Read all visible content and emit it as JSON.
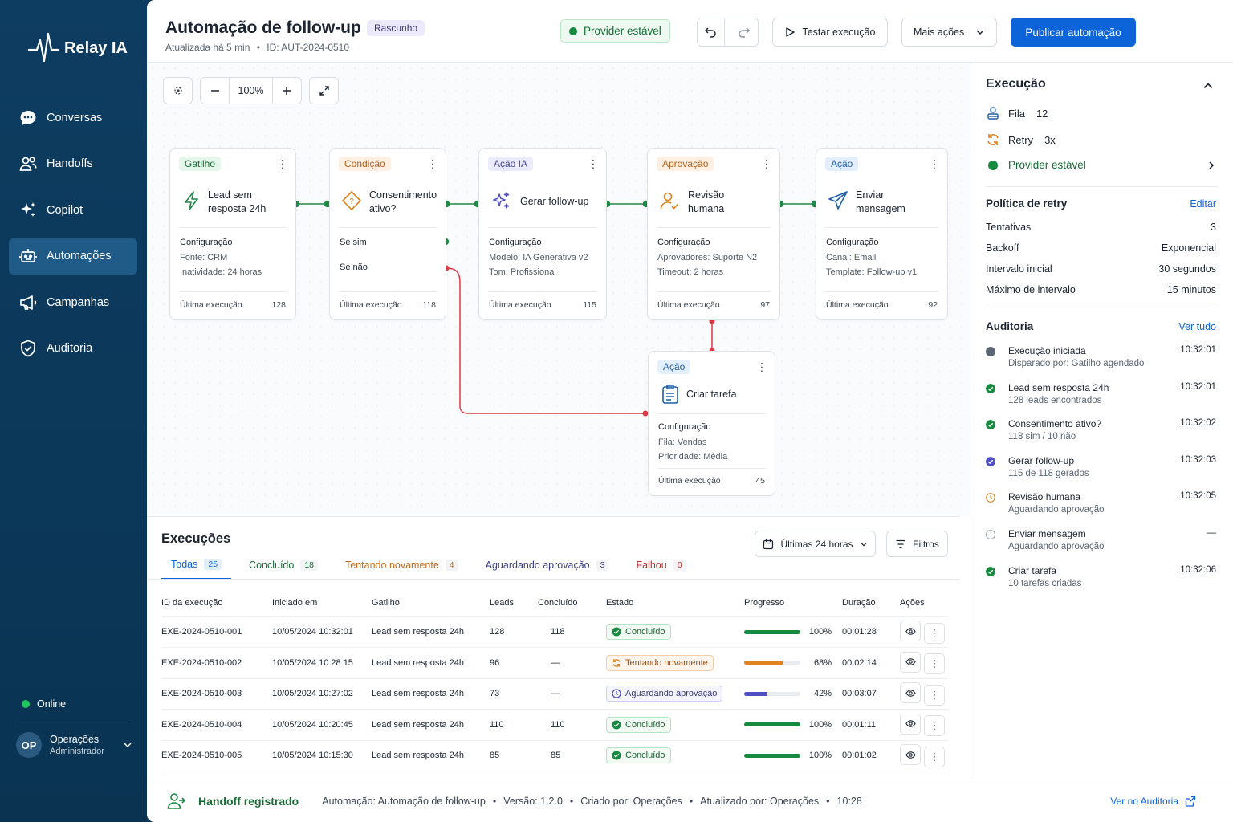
{
  "brand": {
    "name": "Relay IA"
  },
  "nav": [
    {
      "label": "Conversas",
      "icon": "chat-bubble-icon"
    },
    {
      "label": "Handoffs",
      "icon": "users-icon"
    },
    {
      "label": "Copilot",
      "icon": "sparkles-icon"
    },
    {
      "label": "Automações",
      "icon": "robot-icon",
      "active": true
    },
    {
      "label": "Campanhas",
      "icon": "megaphone-icon"
    },
    {
      "label": "Auditoria",
      "icon": "shield-check-icon"
    }
  ],
  "status": {
    "online": "Online"
  },
  "user": {
    "initials": "OP",
    "name": "Operações",
    "role": "Administrador"
  },
  "header": {
    "title": "Automação de follow-up",
    "draft_badge": "Rascunho",
    "updated": "Atualizada há 5 min",
    "separator": "•",
    "id": "ID: AUT-2024-0510",
    "provider_status": "Provider estável",
    "test_label": "Testar execução",
    "more_label": "Mais ações",
    "publish_label": "Publicar automação"
  },
  "canvas": {
    "zoom": "100%"
  },
  "nodes": [
    {
      "tag": "Gatilho",
      "name": [
        "Lead sem",
        "resposta 24h"
      ],
      "conf_title": "Configuração",
      "conf": [
        "Fonte: CRM",
        "Inatividade: 24 horas"
      ],
      "last_label": "Última execução",
      "last": "128"
    },
    {
      "tag": "Condição",
      "name": [
        "Consentimento",
        "ativo?"
      ],
      "branch_yes": "Se sim",
      "branch_no": "Se não",
      "last_label": "Última execução",
      "last": "118"
    },
    {
      "tag": "Ação IA",
      "name": [
        "Gerar follow-up"
      ],
      "conf_title": "Configuração",
      "conf": [
        "Modelo: IA Generativa v2",
        "Tom: Profissional"
      ],
      "last_label": "Última execução",
      "last": "115"
    },
    {
      "tag": "Aprovação",
      "name": [
        "Revisão",
        "humana"
      ],
      "conf_title": "Configuração",
      "conf": [
        "Aprovadores: Suporte N2",
        "Timeout: 2 horas"
      ],
      "last_label": "Última execução",
      "last": "97"
    },
    {
      "tag": "Ação",
      "name": [
        "Enviar",
        "mensagem"
      ],
      "conf_title": "Configuração",
      "conf": [
        "Canal: Email",
        "Template: Follow-up v1"
      ],
      "last_label": "Última execução",
      "last": "92"
    },
    {
      "tag": "Ação",
      "name": [
        "Criar tarefa"
      ],
      "conf_title": "Configuração",
      "conf": [
        "Fila: Vendas",
        "Prioridade: Média"
      ],
      "last_label": "Última execução",
      "last": "45"
    }
  ],
  "executions": {
    "title": "Execuções",
    "range": "Últimas 24 horas",
    "filters": "Filtros",
    "tabs": [
      {
        "label": "Todas",
        "count": "25",
        "color": "#0d63d8"
      },
      {
        "label": "Concluído",
        "count": "18",
        "color": "#1a6a36"
      },
      {
        "label": "Tentando novamente",
        "count": "4",
        "color": "#c46a1c"
      },
      {
        "label": "Aguardando aprovação",
        "count": "3",
        "color": "#3c3f8a"
      },
      {
        "label": "Falhou",
        "count": "0",
        "color": "#c62828"
      }
    ],
    "columns": [
      "ID da execução",
      "Iniciado em",
      "Gatilho",
      "Leads",
      "Concluído",
      "Estado",
      "Progresso",
      "Duração",
      "Ações"
    ],
    "rows": [
      {
        "id": "EXE-2024-0510-001",
        "start": "10/05/2024 10:32:01",
        "trigger": "Lead sem resposta 24h",
        "leads": "128",
        "done": "118",
        "state": "Concluído",
        "kind": "ok",
        "progress": 100,
        "pct": "100%",
        "duration": "00:01:28"
      },
      {
        "id": "EXE-2024-0510-002",
        "start": "10/05/2024 10:28:15",
        "trigger": "Lead sem resposta 24h",
        "leads": "96",
        "done": "—",
        "state": "Tentando novamente",
        "kind": "retry",
        "progress": 68,
        "pct": "68%",
        "duration": "00:02:14"
      },
      {
        "id": "EXE-2024-0510-003",
        "start": "10/05/2024 10:27:02",
        "trigger": "Lead sem resposta 24h",
        "leads": "73",
        "done": "—",
        "state": "Aguardando aprovação",
        "kind": "wait",
        "progress": 42,
        "pct": "42%",
        "duration": "00:03:07"
      },
      {
        "id": "EXE-2024-0510-004",
        "start": "10/05/2024 10:20:45",
        "trigger": "Lead sem resposta 24h",
        "leads": "110",
        "done": "110",
        "state": "Concluído",
        "kind": "ok",
        "progress": 100,
        "pct": "100%",
        "duration": "00:01:11"
      },
      {
        "id": "EXE-2024-0510-005",
        "start": "10/05/2024 10:15:30",
        "trigger": "Lead sem resposta 24h",
        "leads": "85",
        "done": "85",
        "state": "Concluído",
        "kind": "ok",
        "progress": 100,
        "pct": "100%",
        "duration": "00:01:02"
      }
    ]
  },
  "panel": {
    "title": "Execução",
    "queue_label": "Fila",
    "queue": "12",
    "retry_label": "Retry",
    "retry": "3x",
    "provider": "Provider estável",
    "policy_title": "Política de retry",
    "edit": "Editar",
    "policy": [
      {
        "k": "Tentativas",
        "v": "3"
      },
      {
        "k": "Backoff",
        "v": "Exponencial"
      },
      {
        "k": "Intervalo inicial",
        "v": "30 segundos"
      },
      {
        "k": "Máximo de intervalo",
        "v": "15 minutos"
      }
    ],
    "audit_title": "Auditoria",
    "see_all": "Ver tudo",
    "audit": [
      {
        "t1": "Execução iniciada",
        "t2": "Disparado por: Gatilho agendado",
        "time": "10:32:01",
        "kind": "start"
      },
      {
        "t1": "Lead sem resposta 24h",
        "t2": "128 leads encontrados",
        "time": "10:32:01",
        "kind": "ok"
      },
      {
        "t1": "Consentimento ativo?",
        "t2": "118 sim / 10 não",
        "time": "10:32:02",
        "kind": "ok"
      },
      {
        "t1": "Gerar follow-up",
        "t2": "115 de 118 gerados",
        "time": "10:32:03",
        "kind": "ai"
      },
      {
        "t1": "Revisão humana",
        "t2": "Aguardando aprovação",
        "time": "10:32:05",
        "kind": "pending"
      },
      {
        "t1": "Enviar mensagem",
        "t2": "Aguardando aprovação",
        "time": "—",
        "kind": "empty"
      },
      {
        "t1": "Criar tarefa",
        "t2": "10 tarefas criadas",
        "time": "10:32:06",
        "kind": "ok"
      }
    ]
  },
  "footer": {
    "event": "Handoff registrado",
    "sep": "•",
    "automation": "Automação: Automação de follow-up",
    "version": "Versão: 1.2.0",
    "created": "Criado por: Operações",
    "updated": "Atualizado por: Operações",
    "time": "10:28",
    "link": "Ver no Auditoria"
  },
  "colors": {
    "primary": "#0d63d8",
    "success": "#168a3f",
    "warning": "#e0821f",
    "ai": "#4e4fc3",
    "danger": "#d93a44",
    "sidebar": "#0d3d61"
  }
}
